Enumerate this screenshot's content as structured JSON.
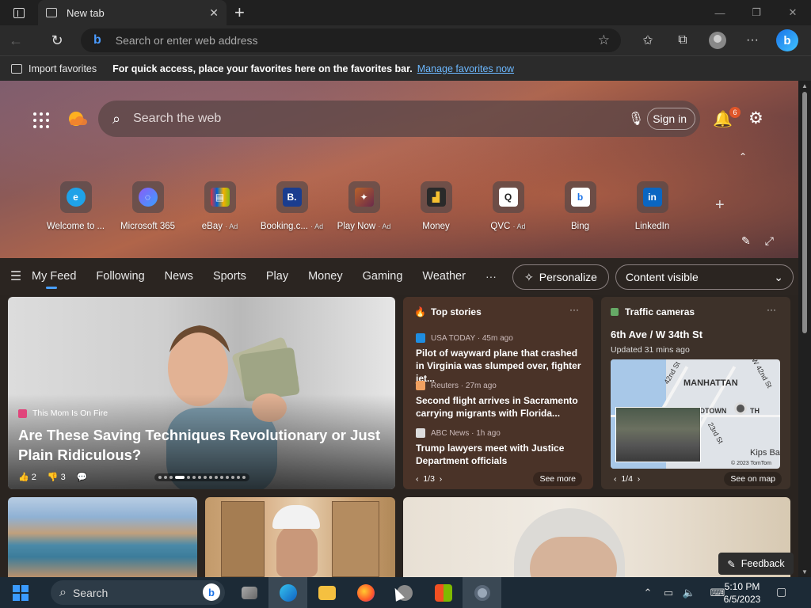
{
  "browser": {
    "tab_title": "New tab",
    "address_placeholder": "Search or enter web address",
    "favorites_bar": {
      "import_label": "Import favorites",
      "message": "For quick access, place your favorites here on the favorites bar.",
      "link": "Manage favorites now"
    }
  },
  "newtab": {
    "search_placeholder": "Search the web",
    "sign_in": "Sign in",
    "notification_count": "6",
    "quick_links": [
      {
        "label": "Welcome to ...",
        "ad": "",
        "icon": "edge-icon",
        "color": "#1fa2e8"
      },
      {
        "label": "Microsoft 365",
        "ad": "",
        "icon": "m365-icon",
        "color": "#8a5cf6"
      },
      {
        "label": "eBay",
        "ad": "· Ad",
        "icon": "ebay-icon",
        "color": "#e53238"
      },
      {
        "label": "Booking.c...",
        "ad": "· Ad",
        "icon": "booking-icon",
        "color": "#1a3d8f"
      },
      {
        "label": "Play Now",
        "ad": "· Ad",
        "icon": "game-icon",
        "color": "#b8622a"
      },
      {
        "label": "Money",
        "ad": "",
        "icon": "money-icon",
        "color": "#3a3a3a"
      },
      {
        "label": "QVC",
        "ad": "· Ad",
        "icon": "qvc-icon",
        "color": "#ffffff"
      },
      {
        "label": "Bing",
        "ad": "",
        "icon": "bing-icon",
        "color": "#ffffff"
      },
      {
        "label": "LinkedIn",
        "ad": "",
        "icon": "linkedin-icon",
        "color": "#0a66c2"
      }
    ],
    "feed_tabs": [
      "My Feed",
      "Following",
      "News",
      "Sports",
      "Play",
      "Money",
      "Gaming",
      "Weather"
    ],
    "personalize_label": "Personalize",
    "content_visible_label": "Content visible",
    "main_card": {
      "source": "This Mom Is On Fire",
      "title": "Are These Saving Techniques Revolutionary or Just Plain Ridiculous?",
      "likes": "2",
      "dislikes": "3"
    },
    "top_stories": {
      "header": "Top stories",
      "stories": [
        {
          "source": "USA TODAY · 45m ago",
          "title": "Pilot of wayward plane that crashed in Virginia was slumped over, fighter jet...",
          "color": "#1f8de0"
        },
        {
          "source": "Reuters · 27m ago",
          "title": "Second flight arrives in Sacramento carrying migrants with Florida...",
          "color": "#f0a060"
        },
        {
          "source": "ABC News · 1h ago",
          "title": "Trump lawyers meet with Justice Department officials",
          "color": "#dddddd"
        }
      ],
      "pager": "1/3",
      "see_more": "See more"
    },
    "traffic": {
      "header": "Traffic cameras",
      "location": "6th Ave / W 34th St",
      "updated": "Updated 31 mins ago",
      "map_labels": {
        "manhattan": "MANHATTAN",
        "street1": "42nd St",
        "street2": "W 42nd St",
        "street3": "23rd St",
        "district": "IDTOWN",
        "south": "TH",
        "kips": "Kips Ba",
        "copyright": "© 2023 TomTom"
      },
      "pager": "1/4",
      "see_on_map": "See on map"
    },
    "feedback": "Feedback"
  },
  "taskbar": {
    "search_label": "Search",
    "time": "5:10 PM",
    "date": "6/5/2023"
  }
}
